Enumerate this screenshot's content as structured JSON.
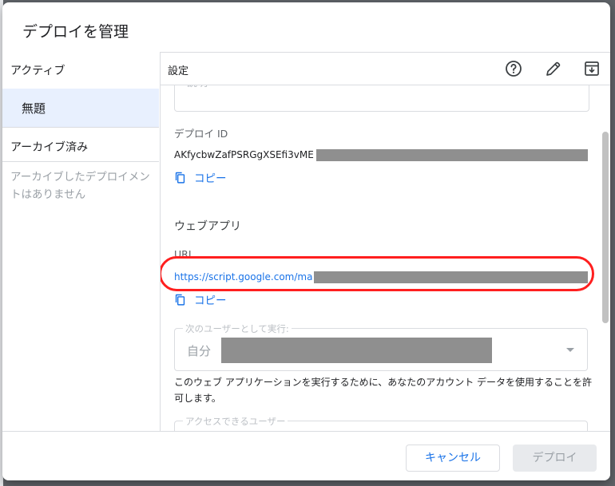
{
  "dialog": {
    "title": "デプロイを管理"
  },
  "sidebar": {
    "active_heading": "アクティブ",
    "active_item": "無題",
    "archived_heading": "アーカイブ済み",
    "archived_empty": "アーカイブしたデプロイメントはありません"
  },
  "toolbar": {
    "label": "設定",
    "icons": [
      "help-icon",
      "edit-pencil-icon",
      "archive-icon"
    ]
  },
  "details": {
    "description_placeholder": "説明",
    "deployment_id_label": "デプロイ ID",
    "deployment_id_value": "AKfycbwZafPSRGgXSEfi3vME",
    "copy_label": "コピー",
    "webapp_section": "ウェブアプリ",
    "url_label": "URL",
    "url_value": "https://script.google.com/ma",
    "execute_as_label": "次のユーザーとして実行:",
    "execute_as_value": "自分",
    "authorization_text": "このウェブ アプリケーションを実行するために、あなたのアカウント データを使用することを許可します。",
    "access_label": "アクセスできるユーザー"
  },
  "footer": {
    "cancel_label": "キャンセル",
    "deploy_label": "デプロイ"
  },
  "colors": {
    "accent": "#1a73e8",
    "selected_bg": "#e8f0fe",
    "highlight_ring": "#ff1f1f",
    "redaction": "#8f8f8f"
  }
}
